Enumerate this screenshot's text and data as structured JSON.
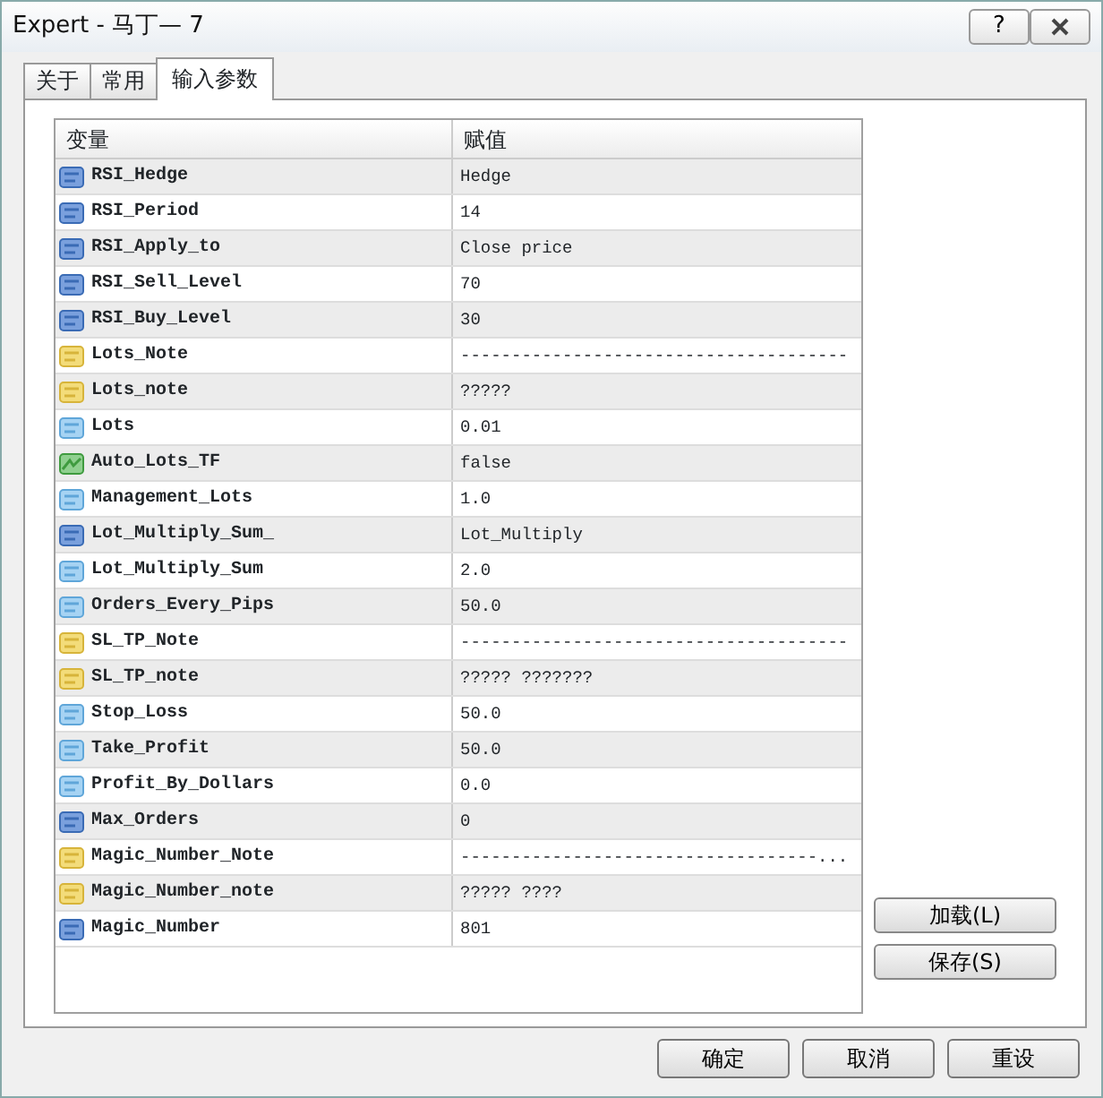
{
  "window": {
    "title": "Expert - 马丁— 7",
    "help": "?"
  },
  "tabs": [
    {
      "label": "关于",
      "selected": false
    },
    {
      "label": "常用",
      "selected": false
    },
    {
      "label": "输入参数",
      "selected": true
    }
  ],
  "table": {
    "columns": [
      "变量",
      "赋值"
    ],
    "rows": [
      {
        "kind": "int",
        "name": "RSI_Hedge",
        "value": "Hedge"
      },
      {
        "kind": "int",
        "name": "RSI_Period",
        "value": "14"
      },
      {
        "kind": "int",
        "name": "RSI_Apply_to",
        "value": "Close price"
      },
      {
        "kind": "int",
        "name": "RSI_Sell_Level",
        "value": "70"
      },
      {
        "kind": "int",
        "name": "RSI_Buy_Level",
        "value": "30"
      },
      {
        "kind": "string",
        "name": "Lots_Note",
        "value": "--------------------------------------"
      },
      {
        "kind": "string",
        "name": "Lots_note",
        "value": "?????"
      },
      {
        "kind": "double",
        "name": "Lots",
        "value": "0.01"
      },
      {
        "kind": "bool",
        "name": "Auto_Lots_TF",
        "value": "false"
      },
      {
        "kind": "double",
        "name": "Management_Lots",
        "value": "1.0"
      },
      {
        "kind": "int",
        "name": "Lot_Multiply_Sum_",
        "value": "Lot_Multiply"
      },
      {
        "kind": "double",
        "name": "Lot_Multiply_Sum",
        "value": "2.0"
      },
      {
        "kind": "double",
        "name": "Orders_Every_Pips",
        "value": "50.0"
      },
      {
        "kind": "string",
        "name": "SL_TP_Note",
        "value": "--------------------------------------"
      },
      {
        "kind": "string",
        "name": "SL_TP_note",
        "value": "????? ???????"
      },
      {
        "kind": "double",
        "name": "Stop_Loss",
        "value": "50.0"
      },
      {
        "kind": "double",
        "name": "Take_Profit",
        "value": "50.0"
      },
      {
        "kind": "double",
        "name": "Profit_By_Dollars",
        "value": "0.0"
      },
      {
        "kind": "int",
        "name": "Max_Orders",
        "value": "0"
      },
      {
        "kind": "string",
        "name": "Magic_Number_Note",
        "value": "-----------------------------------..."
      },
      {
        "kind": "string",
        "name": "Magic_Number_note",
        "value": "????? ????"
      },
      {
        "kind": "int",
        "name": "Magic_Number",
        "value": "801"
      }
    ]
  },
  "side_buttons": [
    "加载(L)",
    "保存(S)"
  ],
  "footer_buttons": [
    "确定",
    "取消",
    "重设"
  ]
}
